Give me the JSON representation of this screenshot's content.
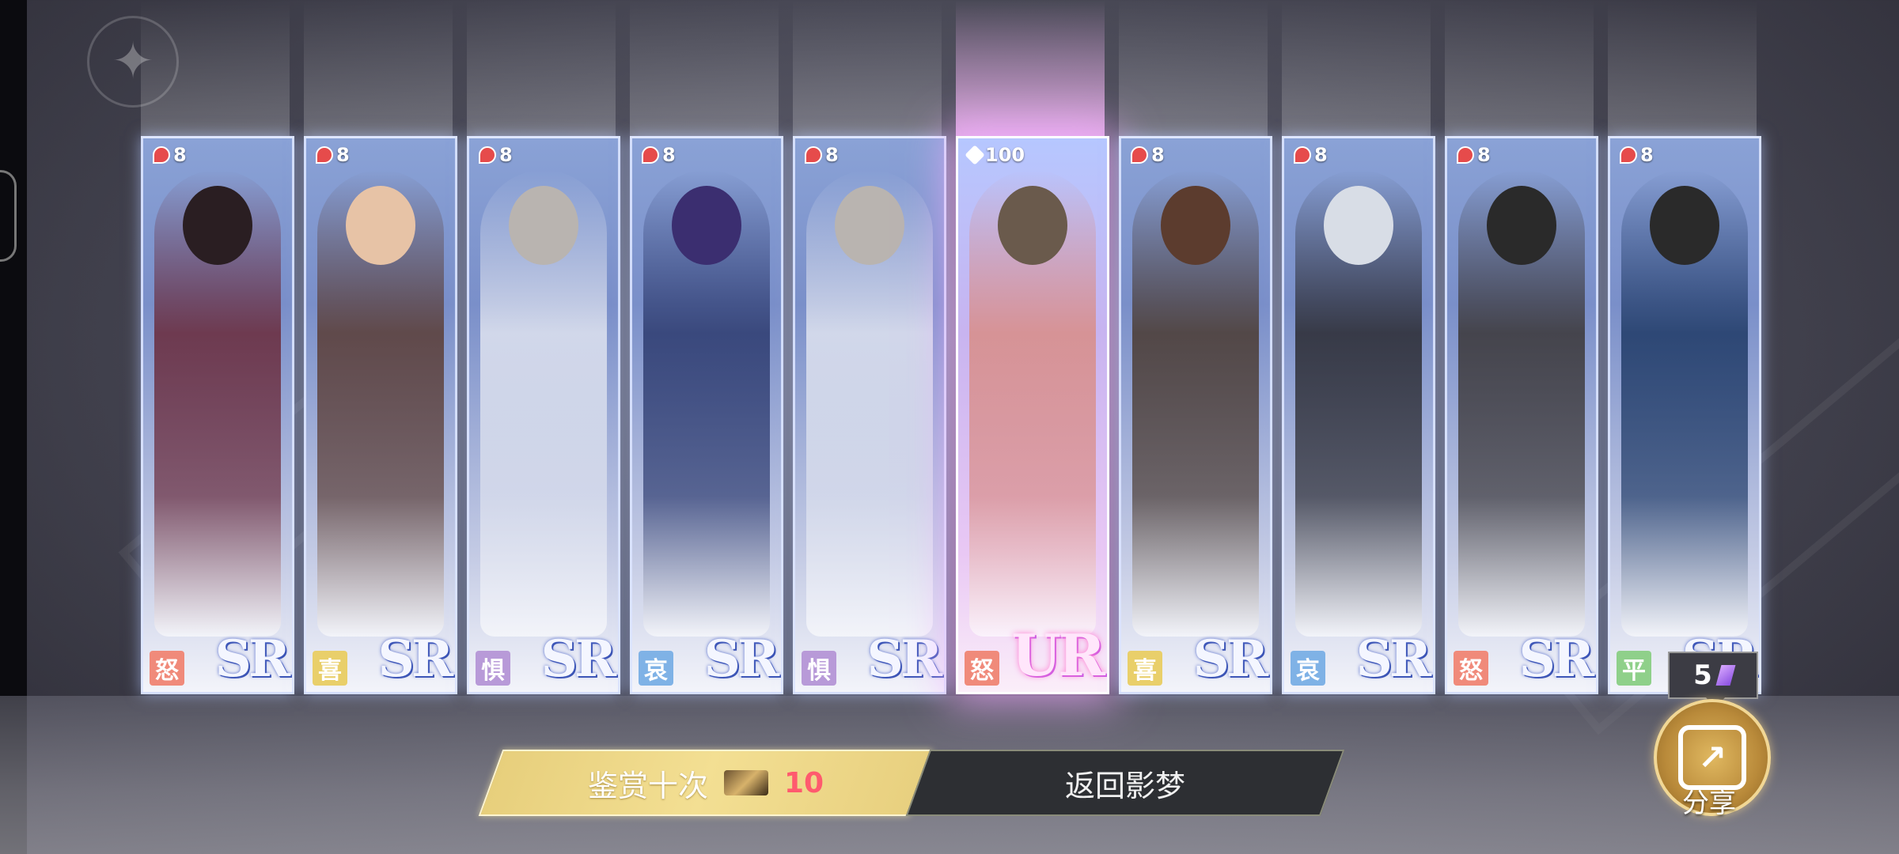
{
  "cards": [
    {
      "cost": "8",
      "emotion": "怒",
      "emotion_color": "#f08a7a",
      "rank": "SR",
      "tone": "#6a2a3a",
      "head": "#2a1e22",
      "ur": false
    },
    {
      "cost": "8",
      "emotion": "喜",
      "emotion_color": "#e9cf6a",
      "rank": "SR",
      "tone": "#5a3c34",
      "head": "#e7c3a6",
      "ur": false
    },
    {
      "cost": "8",
      "emotion": "惧",
      "emotion_color": "#b89ad8",
      "rank": "SR",
      "tone": "#dfe3ef",
      "head": "#b9b4b0",
      "ur": false
    },
    {
      "cost": "8",
      "emotion": "哀",
      "emotion_color": "#7fb2e6",
      "rank": "SR",
      "tone": "#2d3b6f",
      "head": "#3b2e70",
      "ur": false
    },
    {
      "cost": "8",
      "emotion": "惧",
      "emotion_color": "#b89ad8",
      "rank": "SR",
      "tone": "#dfe3ef",
      "head": "#b9b4b0",
      "ur": false
    },
    {
      "cost": "100",
      "emotion": "怒",
      "emotion_color": "#f08a7a",
      "rank": "UR",
      "tone": "#d98d86",
      "head": "#6a5a4c",
      "ur": true
    },
    {
      "cost": "8",
      "emotion": "喜",
      "emotion_color": "#e9cf6a",
      "rank": "SR",
      "tone": "#4a3a30",
      "head": "#5c3c2e",
      "ur": false
    },
    {
      "cost": "8",
      "emotion": "哀",
      "emotion_color": "#7fb2e6",
      "rank": "SR",
      "tone": "#2a2a30",
      "head": "#d8dde6",
      "ur": false
    },
    {
      "cost": "8",
      "emotion": "怒",
      "emotion_color": "#f08a7a",
      "rank": "SR",
      "tone": "#3a3636",
      "head": "#2a2a2a",
      "ur": false
    },
    {
      "cost": "8",
      "emotion": "平",
      "emotion_color": "#8fd08a",
      "rank": "SR",
      "tone": "#1f3a66",
      "head": "#2a2a2a",
      "ur": false
    }
  ],
  "buttons": {
    "appraise_label": "鉴赏十次",
    "appraise_cost": "10",
    "return_label": "返回影梦"
  },
  "share": {
    "count": "5",
    "label": "分享"
  }
}
